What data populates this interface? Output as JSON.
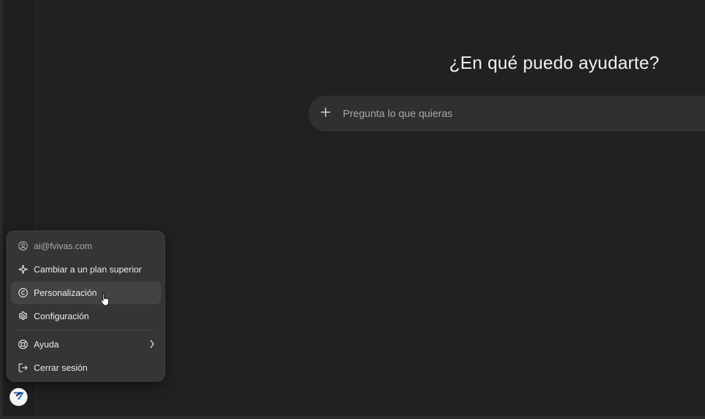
{
  "main": {
    "headline": "¿En qué puedo ayudarte?",
    "composer": {
      "placeholder": "Pregunta lo que quieras",
      "value": ""
    }
  },
  "account_menu": {
    "email": "ai@fvivas.com",
    "items": [
      {
        "label": "Cambiar a un plan superior",
        "icon": "sparkle-icon"
      },
      {
        "label": "Personalización",
        "icon": "personalize-icon"
      },
      {
        "label": "Configuración",
        "icon": "gear-icon"
      },
      {
        "label": "Ayuda",
        "icon": "lifebuoy-icon"
      },
      {
        "label": "Cerrar sesión",
        "icon": "logout-icon"
      }
    ]
  },
  "colors": {
    "background": "#212121",
    "menu_background": "#353535",
    "menu_hover": "#434343",
    "composer_background": "#303030"
  }
}
